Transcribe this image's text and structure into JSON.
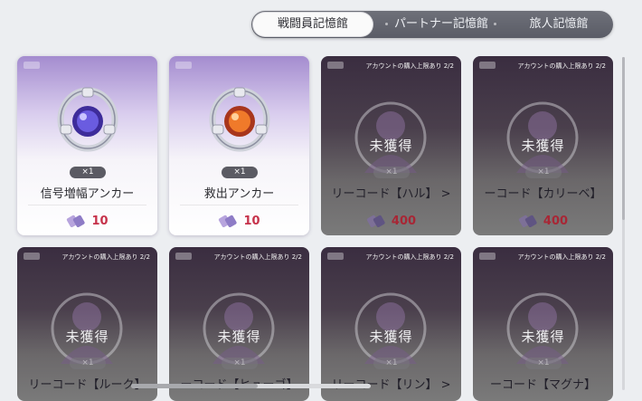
{
  "tabs": [
    {
      "label": "戦闘員記憶館",
      "active": true
    },
    {
      "label": "パートナー記憶館",
      "active": false
    },
    {
      "label": "旅人記憶館",
      "active": false
    }
  ],
  "status_locked": "未獲得",
  "currency_icon": "ticket-icon",
  "cards": [
    {
      "name": "信号増幅アンカー",
      "qty": "×1",
      "price": "10",
      "owned": true,
      "limit": "",
      "icon": "anchor-blue-icon"
    },
    {
      "name": "救出アンカー",
      "qty": "×1",
      "price": "10",
      "owned": true,
      "limit": "",
      "icon": "anchor-orange-icon"
    },
    {
      "name": "リーコード【ハル】 >",
      "qty": "×1",
      "price": "400",
      "owned": false,
      "limit": "アカウントの購入上限あり 2/2"
    },
    {
      "name": "ーコード【カリーベ】",
      "qty": "×1",
      "price": "400",
      "owned": false,
      "limit": "アカウントの購入上限あり 2/2"
    },
    {
      "name": "リーコード【ルーク】",
      "qty": "×1",
      "price": "",
      "owned": false,
      "limit": "アカウントの購入上限あり 2/2"
    },
    {
      "name": "ーコード【ヒューゴ】",
      "qty": "×1",
      "price": "",
      "owned": false,
      "limit": "アカウントの購入上限あり 2/2"
    },
    {
      "name": "リーコード【リン】 >",
      "qty": "×1",
      "price": "",
      "owned": false,
      "limit": "アカウントの購入上限あり 2/2"
    },
    {
      "name": "ーコード【マグナ】",
      "qty": "×1",
      "price": "",
      "owned": false,
      "limit": "アカウントの購入上限あり 2/2"
    }
  ],
  "colors": {
    "price": "#c6324a",
    "tab_bg": "#62646d",
    "owned_card_top": "#a48ccf"
  }
}
